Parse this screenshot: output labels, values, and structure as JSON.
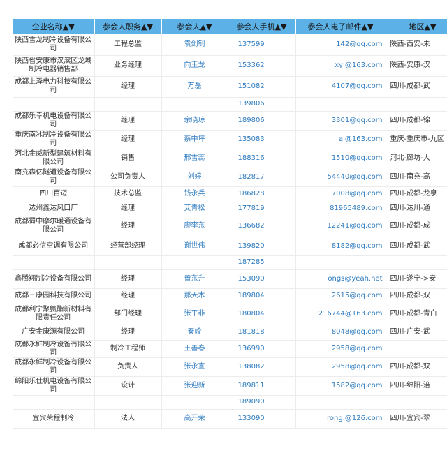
{
  "table": {
    "headers": [
      "企业名称▲▼",
      "参会人职务▲▼",
      "参会人▲▼",
      "参会人手机▲▼",
      "参会人电子邮件▲▼",
      "地区▲▼"
    ],
    "rows": [
      {
        "company": "陕西雪龙制冷设备有限公司",
        "title": "工程总监",
        "person": "袁剑钊",
        "phone": "137599",
        "email": "142@qq.com",
        "region": "陕西-西安-未"
      },
      {
        "company": "陕西省安康市汉滨区龙城制冷电器销售部",
        "title": "业务经理",
        "person": "向玉龙",
        "phone": "153362",
        "email": "xyl@163.com",
        "region": "陕西-安康-汉"
      },
      {
        "company": "成都上泽电力科技有限公司",
        "title": "经理",
        "person": "万磊",
        "phone": "151082",
        "email": "4107@qq.com",
        "region": "四川-成都-武"
      },
      {
        "company": "",
        "title": "",
        "person": "",
        "phone": "139806",
        "email": "",
        "region": ""
      },
      {
        "company": "成都乐幸机电设备有限公司",
        "title": "经理",
        "person": "余晓琼",
        "phone": "189806",
        "email": "3301@qq.com",
        "region": "四川-成都-锦"
      },
      {
        "company": "重庆南冰制冷设备有限公司",
        "title": "经理",
        "person": "蔡中坪",
        "phone": "135083",
        "email": "ai@163.com",
        "region": "重庆-重庆市-九区"
      },
      {
        "company": "河北金威新型建筑材料有限公司",
        "title": "销售",
        "person": "邢雪蕊",
        "phone": "188316",
        "email": "1510@qq.com",
        "region": "河北-廊坊-大"
      },
      {
        "company": "南充森亿隧道设备有限公司",
        "title": "公司负责人",
        "person": "刘婷",
        "phone": "182817",
        "email": "54440@qq.com",
        "region": "四川-南充-高"
      },
      {
        "company": "四川百迈",
        "title": "技术总监",
        "person": "钱永兵",
        "phone": "186828",
        "email": "7008@qq.com",
        "region": "四川-成都-龙泉"
      },
      {
        "company": "达州鑫达风口厂",
        "title": "经理",
        "person": "艾青松",
        "phone": "177819",
        "email": "81965489.com",
        "region": "四川-达川-通"
      },
      {
        "company": "成都蜀中摩尔暖通设备有限公司",
        "title": "经理",
        "person": "廖李东",
        "phone": "136682",
        "email": "12241@qq.com",
        "region": "四川-成都-成"
      },
      {
        "company": "成都必信空调有限公司",
        "title": "经营部经理",
        "person": "谢世伟",
        "phone": "139820",
        "email": "8182@qq.com",
        "region": "四川-成都-武"
      },
      {
        "company": "",
        "title": "",
        "person": "",
        "phone": "187285",
        "email": "",
        "region": ""
      },
      {
        "company": "鑫腾翔制冷设备有限公司",
        "title": "经理",
        "person": "曾东升",
        "phone": "153090",
        "email": "ongs@yeah.net",
        "region": "四川-遂宁->安"
      },
      {
        "company": "成都三康园科技有限公司",
        "title": "经理",
        "person": "那天木",
        "phone": "189804",
        "email": "2615@qq.com",
        "region": "四川-成都-双"
      },
      {
        "company": "成都利宁聚氨酯新材料有限责任公司",
        "title": "部门经理",
        "person": "张平非",
        "phone": "180804",
        "email": "216744@163.com",
        "region": "四川-成都-青白"
      },
      {
        "company": "广安金康源有限公司",
        "title": "经理",
        "person": "秦岭",
        "phone": "181818",
        "email": "8048@qq.com",
        "region": "四川-广安-武"
      },
      {
        "company": "成都永鲜制冷设备有限公司",
        "title": "制冷工程师",
        "person": "王善春",
        "phone": "136990",
        "email": "2958@qq.com",
        "region": ""
      },
      {
        "company": "成都永鲜制冷设备有限公司",
        "title": "负责人",
        "person": "张永宣",
        "phone": "138082",
        "email": "2958@qq.com",
        "region": "四川-成都-双"
      },
      {
        "company": "绵阳乐仕机电设备有限公司",
        "title": "设计",
        "person": "张迎新",
        "phone": "189811",
        "email": "1582@qq.com",
        "region": "四川-绵阳-涪"
      },
      {
        "company": "",
        "title": "",
        "person": "",
        "phone": "189090",
        "email": "",
        "region": ""
      },
      {
        "company": "宜宾荣程制冷",
        "title": "法人",
        "person": "高开荣",
        "phone": "133090",
        "email": "rong.@126.com",
        "region": "四川-宜宾-翠"
      }
    ]
  }
}
